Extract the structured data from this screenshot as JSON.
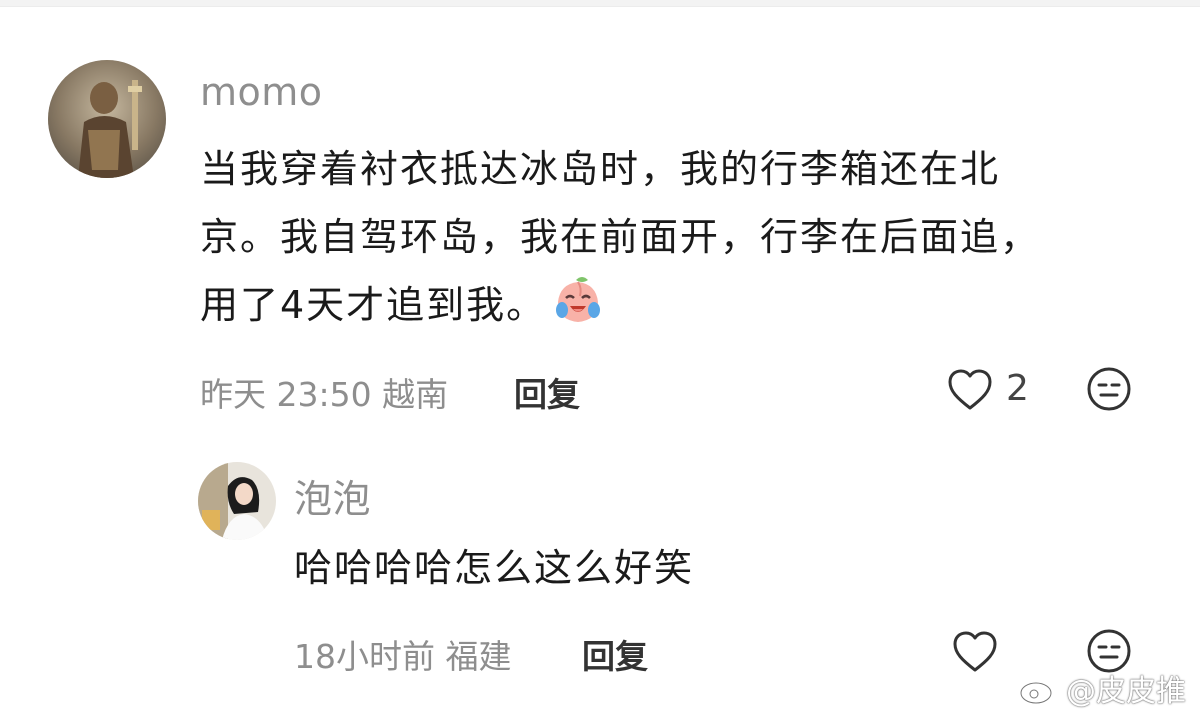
{
  "comments": [
    {
      "username": "momo",
      "text_lines": [
        "当我穿着衬衣抵达冰岛时，我的行李箱还在北",
        "京。我自驾环岛，我在前面开，行李在后面追，",
        "用了4天才追到我。"
      ],
      "emoji_icon": "crying-laughing-peach-emoji-icon",
      "time": "昨天 23:50",
      "location": "越南",
      "reply_label": "回复",
      "like_count": "2"
    },
    {
      "username": "泡泡",
      "text": "哈哈哈哈怎么这么好笑",
      "time": "18小时前",
      "location": "福建",
      "reply_label": "回复"
    }
  ],
  "watermark": "@皮皮推",
  "colors": {
    "meta": "#8e8e8e",
    "text": "#1a1a1a",
    "icon": "#333333"
  }
}
